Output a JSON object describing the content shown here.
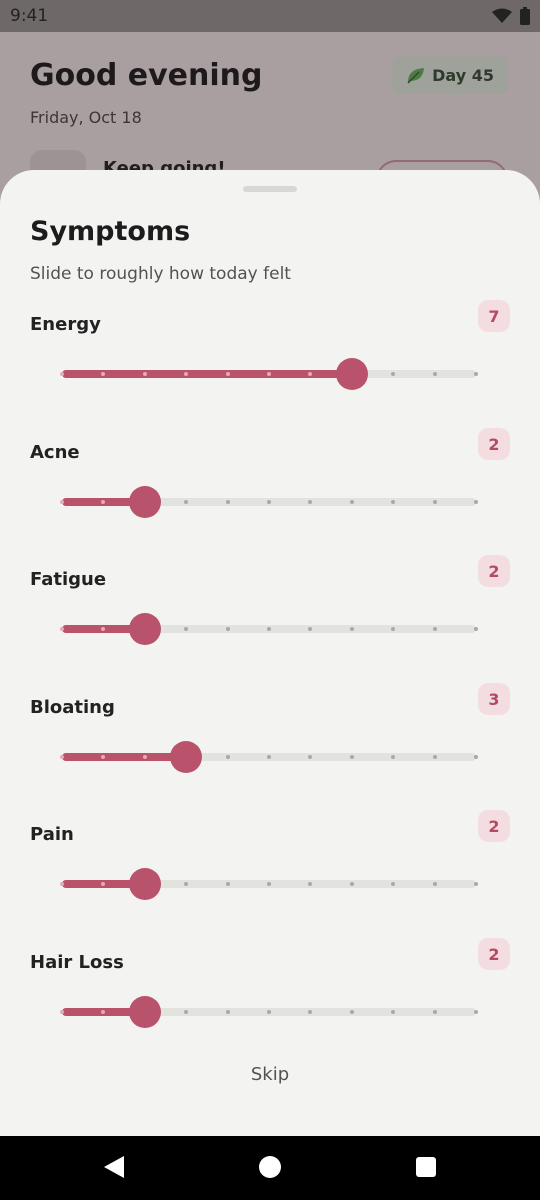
{
  "status_bar": {
    "time": "9:41",
    "icons": [
      "wifi-icon",
      "battery-icon"
    ]
  },
  "background_screen": {
    "greeting": "Good evening",
    "date": "Friday, Oct 18",
    "day_chip": {
      "icon": "leaf-icon",
      "label": "Day 45"
    },
    "card_text": "Keep going!"
  },
  "sheet": {
    "title": "Symptoms",
    "subtitle": "Slide to roughly how today felt",
    "scale": {
      "min": 0,
      "max": 10
    },
    "symptoms": [
      {
        "label": "Energy",
        "value": 7
      },
      {
        "label": "Acne",
        "value": 2
      },
      {
        "label": "Fatigue",
        "value": 2
      },
      {
        "label": "Bloating",
        "value": 3
      },
      {
        "label": "Pain",
        "value": 2
      },
      {
        "label": "Hair Loss",
        "value": 2
      }
    ],
    "skip_label": "Skip"
  },
  "colors": {
    "accent": "#b9536b",
    "badge_bg": "#f4dde1",
    "track": "#e2e2df",
    "sheet_bg": "#f3f4f2"
  },
  "nav_bar": {
    "icons": [
      "back-icon",
      "home-icon",
      "recents-icon"
    ]
  }
}
